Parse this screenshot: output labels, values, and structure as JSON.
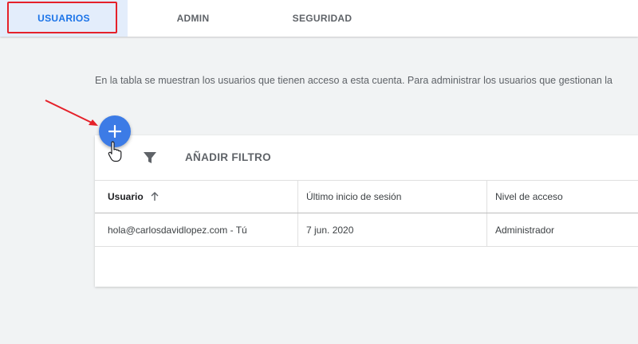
{
  "tabs": [
    {
      "label": "USUARIOS",
      "active": true
    },
    {
      "label": "ADMIN",
      "active": false
    },
    {
      "label": "SEGURIDAD",
      "active": false
    }
  ],
  "description": "En la tabla se muestran los usuarios que tienen acceso a esta cuenta. Para administrar los usuarios que gestionan la",
  "toolbar": {
    "add_icon": "plus-icon",
    "filter_icon": "filter-icon",
    "filter_label": "AÑADIR FILTRO"
  },
  "table": {
    "columns": [
      {
        "label": "Usuario",
        "sorted": "ascending"
      },
      {
        "label": "Último inicio de sesión"
      },
      {
        "label": "Nivel de acceso"
      }
    ],
    "rows": [
      [
        "hola@carlosdavidlopez.com - Tú",
        "7 jun. 2020",
        "Administrador"
      ]
    ]
  },
  "colors": {
    "accent": "#1a73e8",
    "fab": "#3c7be6",
    "annotation": "#e5212a",
    "active_tab_bg": "#e3edfb"
  }
}
